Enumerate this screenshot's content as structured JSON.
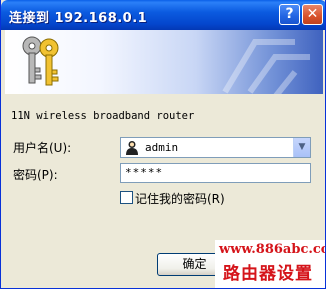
{
  "dialog": {
    "title": "连接到 192.168.0.1",
    "help_symbol": "?",
    "close_symbol": "✕"
  },
  "banner": {
    "icon": "keys-icon",
    "watermark_icon": "router-watermark-icon"
  },
  "form": {
    "model_text": "11N wireless broadband router",
    "username_label": "用户名(U):",
    "username_value": "admin",
    "password_label": "密码(P):",
    "password_value": "*****",
    "remember_label": "记住我的密码(R)",
    "remember_checked": false
  },
  "buttons": {
    "ok_label": "确定"
  },
  "watermark": {
    "url": "www.886abc.com",
    "site": "路由器设置",
    "color": "#d5141a"
  }
}
